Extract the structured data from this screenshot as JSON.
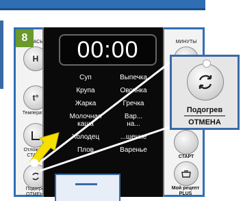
{
  "step": {
    "number": "8"
  },
  "display": {
    "time": "00:00"
  },
  "menu": {
    "items": [
      "Суп",
      "Выпечка",
      "Крупа",
      "Овсянка",
      "Жарка",
      "Гречка",
      "Молочная\nкаша",
      "Вар...\nна...",
      "Холодец",
      "...шение",
      "Плов",
      "Варенье"
    ]
  },
  "left_buttons": {
    "hours_label": "ЧАСЫ",
    "hours_symbol": "Н",
    "temp_symbol": "t°",
    "temp_label": "Температура",
    "delay_label": "Отложен\nСТА...",
    "reheat_label": "Подогрев\nОТМЕНА"
  },
  "right_buttons": {
    "minutes_label": "МИНУТЫ",
    "start_label": "СТАРТ",
    "recipe_label": "Мой рецепт\nPLUS"
  },
  "zoom": {
    "line1": "Подогрев",
    "line2": "ОТМЕНА"
  },
  "colors": {
    "accent": "#2f6eb5",
    "badge": "#6a9a2b",
    "arrow": "#f5e000"
  }
}
